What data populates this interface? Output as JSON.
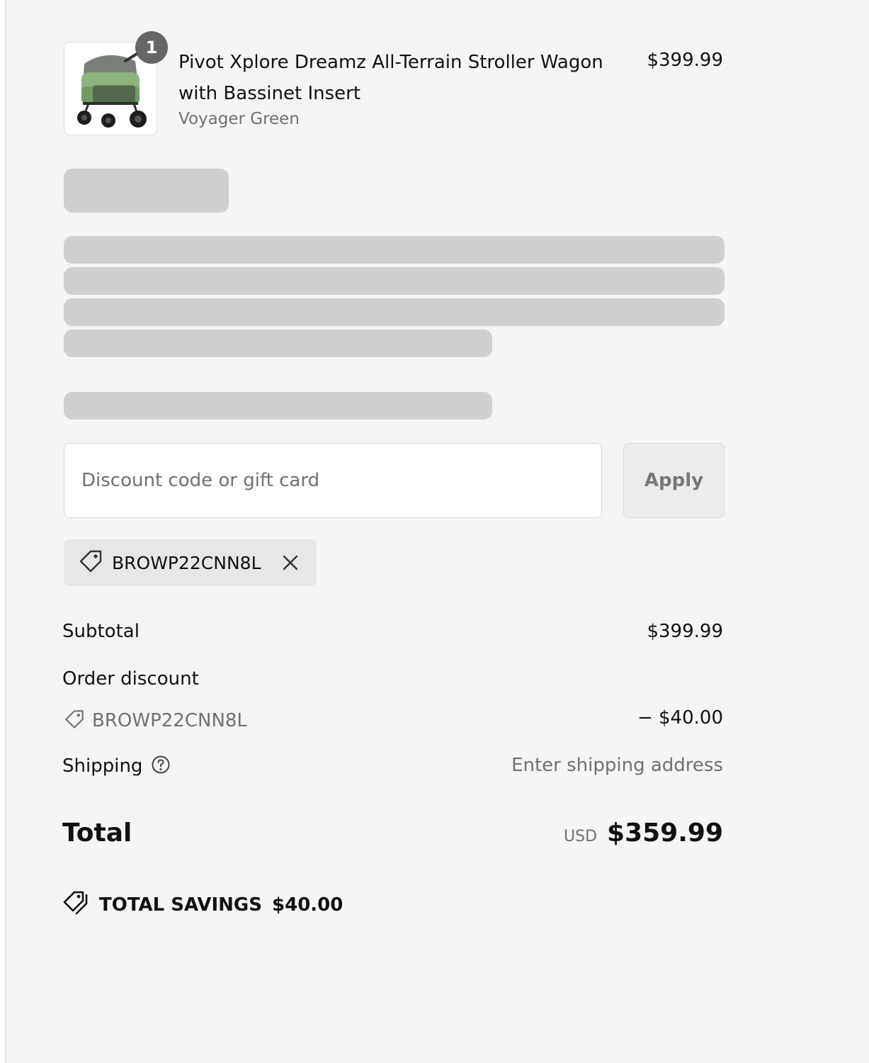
{
  "product": {
    "quantity": "1",
    "name": "Pivot Xplore Dreamz All-Terrain Stroller Wagon with Bassinet Insert",
    "variant": "Voyager Green",
    "price": "$399.99",
    "image_icon": "stroller-wagon-thumbnail"
  },
  "discount": {
    "placeholder": "Discount code or gift card",
    "apply_label": "Apply",
    "applied_code": "BROWP22CNN8L"
  },
  "summary": {
    "subtotal_label": "Subtotal",
    "subtotal_value": "$399.99",
    "order_discount_label": "Order discount",
    "order_discount_code": "BROWP22CNN8L",
    "order_discount_value": "− $40.00",
    "shipping_label": "Shipping",
    "shipping_value": "Enter shipping address",
    "total_label": "Total",
    "currency": "USD",
    "total_value": "$359.99",
    "savings_label": "TOTAL SAVINGS",
    "savings_value": "$40.00"
  },
  "colors": {
    "background": "#f5f5f5",
    "skeleton": "#cfcfcf",
    "badge": "#666666"
  }
}
